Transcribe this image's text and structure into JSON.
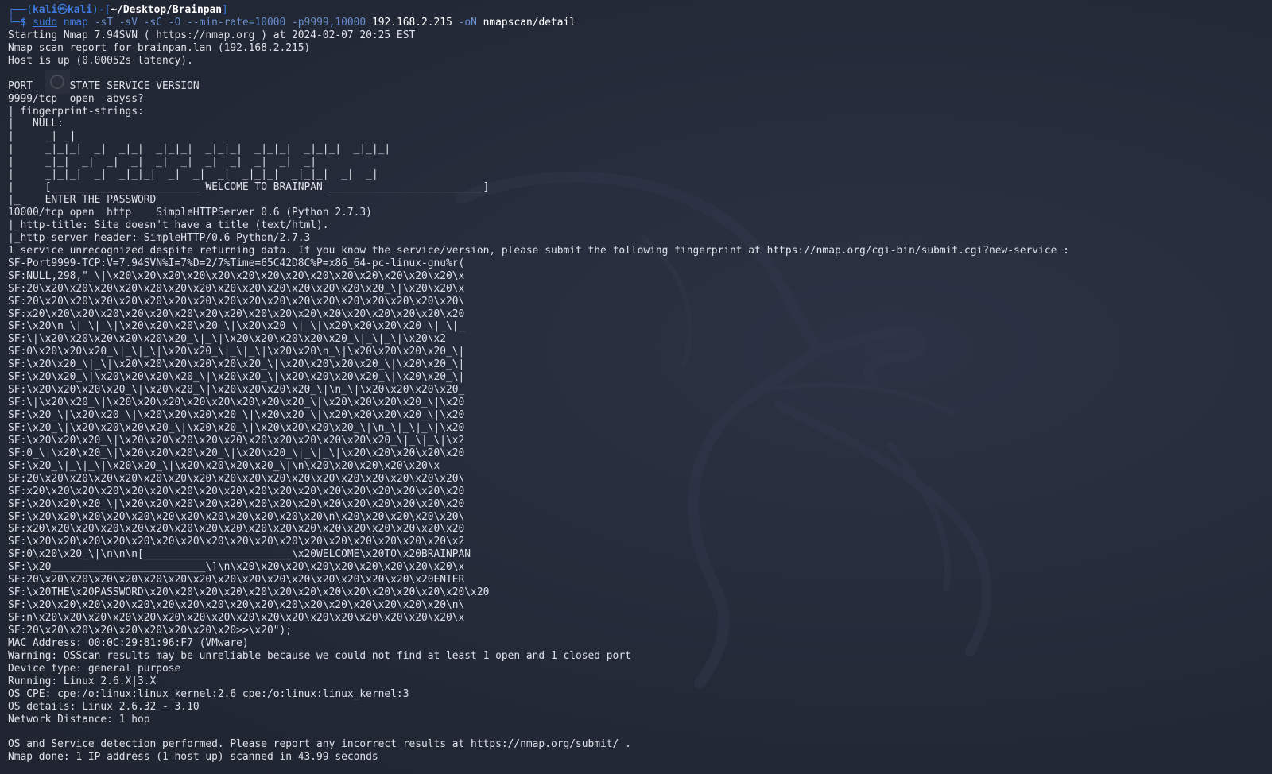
{
  "prompt": {
    "box_left": "┌──(",
    "user": "kali",
    "at": "㉿",
    "host": "kali",
    "mid": ")-[",
    "path": "~/Desktop/Brainpan",
    "close": "]",
    "line2_prefix": "└─",
    "dollar": "$ "
  },
  "command": {
    "sudo": "sudo",
    "main": " nmap ",
    "flags": "-sT -sV -sC -O --min-rate=10000 -p9999,10000 ",
    "target": "192.168.2.215 ",
    "out_flag": "-oN ",
    "out_file": "nmapscan/detail"
  },
  "output_lines": [
    "Starting Nmap 7.94SVN ( https://nmap.org ) at 2024-02-07 20:25 EST",
    "Nmap scan report for brainpan.lan (192.168.2.215)",
    "Host is up (0.00052s latency).",
    "",
    "PORT      STATE SERVICE VERSION",
    "9999/tcp  open  abyss?",
    "| fingerprint-strings:",
    "|   NULL:",
    "|     _| _|",
    "|     _|_|_|  _|  _|_|  _|_|_|  _|_|_|  _|_|_|  _|_|_|  _|_|_|",
    "|     _|_|  _|  _|  _|  _|  _|  _|  _|  _|  _|  _|",
    "|     _|_|_|  _|  _|_|_|  _|  _|  _|  _|_|_|  _|_|_|  _|  _|",
    "|     [________________________ WELCOME TO BRAINPAN _________________________]",
    "|_    ENTER THE PASSWORD",
    "10000/tcp open  http    SimpleHTTPServer 0.6 (Python 2.7.3)",
    "|_http-title: Site doesn't have a title (text/html).",
    "|_http-server-header: SimpleHTTP/0.6 Python/2.7.3",
    "1 service unrecognized despite returning data. If you know the service/version, please submit the following fingerprint at https://nmap.org/cgi-bin/submit.cgi?new-service :",
    "SF-Port9999-TCP:V=7.94SVN%I=7%D=2/7%Time=65C42D8C%P=x86_64-pc-linux-gnu%r(",
    "SF:NULL,298,\"_\\|\\x20\\x20\\x20\\x20\\x20\\x20\\x20\\x20\\x20\\x20\\x20\\x20\\x20\\x20\\x",
    "SF:20\\x20\\x20\\x20\\x20\\x20\\x20\\x20\\x20\\x20\\x20\\x20\\x20\\x20\\x20_\\|\\x20\\x20\\x",
    "SF:20\\x20\\x20\\x20\\x20\\x20\\x20\\x20\\x20\\x20\\x20\\x20\\x20\\x20\\x20\\x20\\x20\\x20\\",
    "SF:x20\\x20\\x20\\x20\\x20\\x20\\x20\\x20\\x20\\x20\\x20\\x20\\x20\\x20\\x20\\x20\\x20\\x20",
    "SF:\\x20\\n_\\|_\\|_\\|\\x20\\x20\\x20\\x20_\\|\\x20\\x20_\\|_\\|\\x20\\x20\\x20\\x20_\\|_\\|_",
    "SF:\\|\\x20\\x20\\x20\\x20\\x20\\x20_\\|_\\|\\x20\\x20\\x20\\x20\\x20_\\|_\\|_\\|\\x20\\x2",
    "SF:0\\x20\\x20\\x20_\\|_\\|_\\|\\x20\\x20_\\|_\\|_\\|\\x20\\x20\\n_\\|\\x20\\x20\\x20\\x20_\\|",
    "SF:\\x20\\x20_\\|_\\|\\x20\\x20\\x20\\x20\\x20\\x20_\\|\\x20\\x20\\x20\\x20_\\|\\x20\\x20_\\|",
    "SF:\\x20\\x20_\\|\\x20\\x20\\x20\\x20_\\|\\x20\\x20_\\|\\x20\\x20\\x20\\x20_\\|\\x20\\x20_\\|",
    "SF:\\x20\\x20\\x20\\x20_\\|\\x20\\x20_\\|\\x20\\x20\\x20\\x20_\\|\\n_\\|\\x20\\x20\\x20\\x20_",
    "SF:\\|\\x20\\x20_\\|\\x20\\x20\\x20\\x20\\x20\\x20\\x20\\x20_\\|\\x20\\x20\\x20\\x20_\\|\\x20",
    "SF:\\x20_\\|\\x20\\x20_\\|\\x20\\x20\\x20\\x20_\\|\\x20\\x20_\\|\\x20\\x20\\x20\\x20_\\|\\x20",
    "SF:\\x20_\\|\\x20\\x20\\x20\\x20_\\|\\x20\\x20_\\|\\x20\\x20\\x20\\x20_\\|\\n_\\|_\\|_\\|\\x20",
    "SF:\\x20\\x20\\x20_\\|\\x20\\x20\\x20\\x20\\x20\\x20\\x20\\x20\\x20\\x20\\x20_\\|_\\|_\\|\\x2",
    "SF:0_\\|\\x20\\x20_\\|\\x20\\x20\\x20\\x20_\\|\\x20\\x20_\\|_\\|_\\|\\x20\\x20\\x20\\x20\\x20",
    "SF:\\x20_\\|_\\|_\\|\\x20\\x20_\\|\\x20\\x20\\x20\\x20_\\|\\n\\x20\\x20\\x20\\x20\\x20\\x",
    "SF:20\\x20\\x20\\x20\\x20\\x20\\x20\\x20\\x20\\x20\\x20\\x20\\x20\\x20\\x20\\x20\\x20\\x20\\",
    "SF:x20\\x20\\x20\\x20\\x20\\x20\\x20\\x20\\x20\\x20\\x20\\x20\\x20\\x20\\x20\\x20\\x20\\x20",
    "SF:\\x20\\x20\\x20_\\|\\x20\\x20\\x20\\x20\\x20\\x20\\x20\\x20\\x20\\x20\\x20\\x20\\x20\\x20",
    "SF:\\x20\\x20\\x20\\x20\\x20\\x20\\x20\\x20\\x20\\x20\\x20\\x20\\n\\x20\\x20\\x20\\x20\\x20\\",
    "SF:x20\\x20\\x20\\x20\\x20\\x20\\x20\\x20\\x20\\x20\\x20\\x20\\x20\\x20\\x20\\x20\\x20\\x20",
    "SF:\\x20\\x20\\x20\\x20\\x20\\x20\\x20\\x20\\x20\\x20\\x20\\x20\\x20\\x20\\x20\\x20\\x20\\x2",
    "SF:0\\x20\\x20_\\|\\n\\n\\n[________________________\\x20WELCOME\\x20TO\\x20BRAINPAN",
    "SF:\\x20_________________________\\]\\n\\x20\\x20\\x20\\x20\\x20\\x20\\x20\\x20\\x20\\x",
    "SF:20\\x20\\x20\\x20\\x20\\x20\\x20\\x20\\x20\\x20\\x20\\x20\\x20\\x20\\x20\\x20\\x20ENTER",
    "SF:\\x20THE\\x20PASSWORD\\x20\\x20\\x20\\x20\\x20\\x20\\x20\\x20\\x20\\x20\\x20\\x20\\x20\\x20",
    "SF:\\x20\\x20\\x20\\x20\\x20\\x20\\x20\\x20\\x20\\x20\\x20\\x20\\x20\\x20\\x20\\x20\\x20\\n\\",
    "SF:n\\x20\\x20\\x20\\x20\\x20\\x20\\x20\\x20\\x20\\x20\\x20\\x20\\x20\\x20\\x20\\x20\\x20\\x",
    "SF:20\\x20\\x20\\x20\\x20\\x20\\x20\\x20\\x20>>\\x20\");",
    "MAC Address: 00:0C:29:81:96:F7 (VMware)",
    "Warning: OSScan results may be unreliable because we could not find at least 1 open and 1 closed port",
    "Device type: general purpose",
    "Running: Linux 2.6.X|3.X",
    "OS CPE: cpe:/o:linux:linux_kernel:2.6 cpe:/o:linux:linux_kernel:3",
    "OS details: Linux 2.6.32 - 3.10",
    "Network Distance: 1 hop",
    "",
    "OS and Service detection performed. Please report any incorrect results at https://nmap.org/submit/ .",
    "Nmap done: 1 IP address (1 host up) scanned in 43.99 seconds"
  ],
  "colors": {
    "background": "#232936",
    "text": "#dde1e8",
    "prompt_accent": "#3f7be0"
  },
  "icons": {
    "background_logo": "kali-dragon-icon"
  }
}
